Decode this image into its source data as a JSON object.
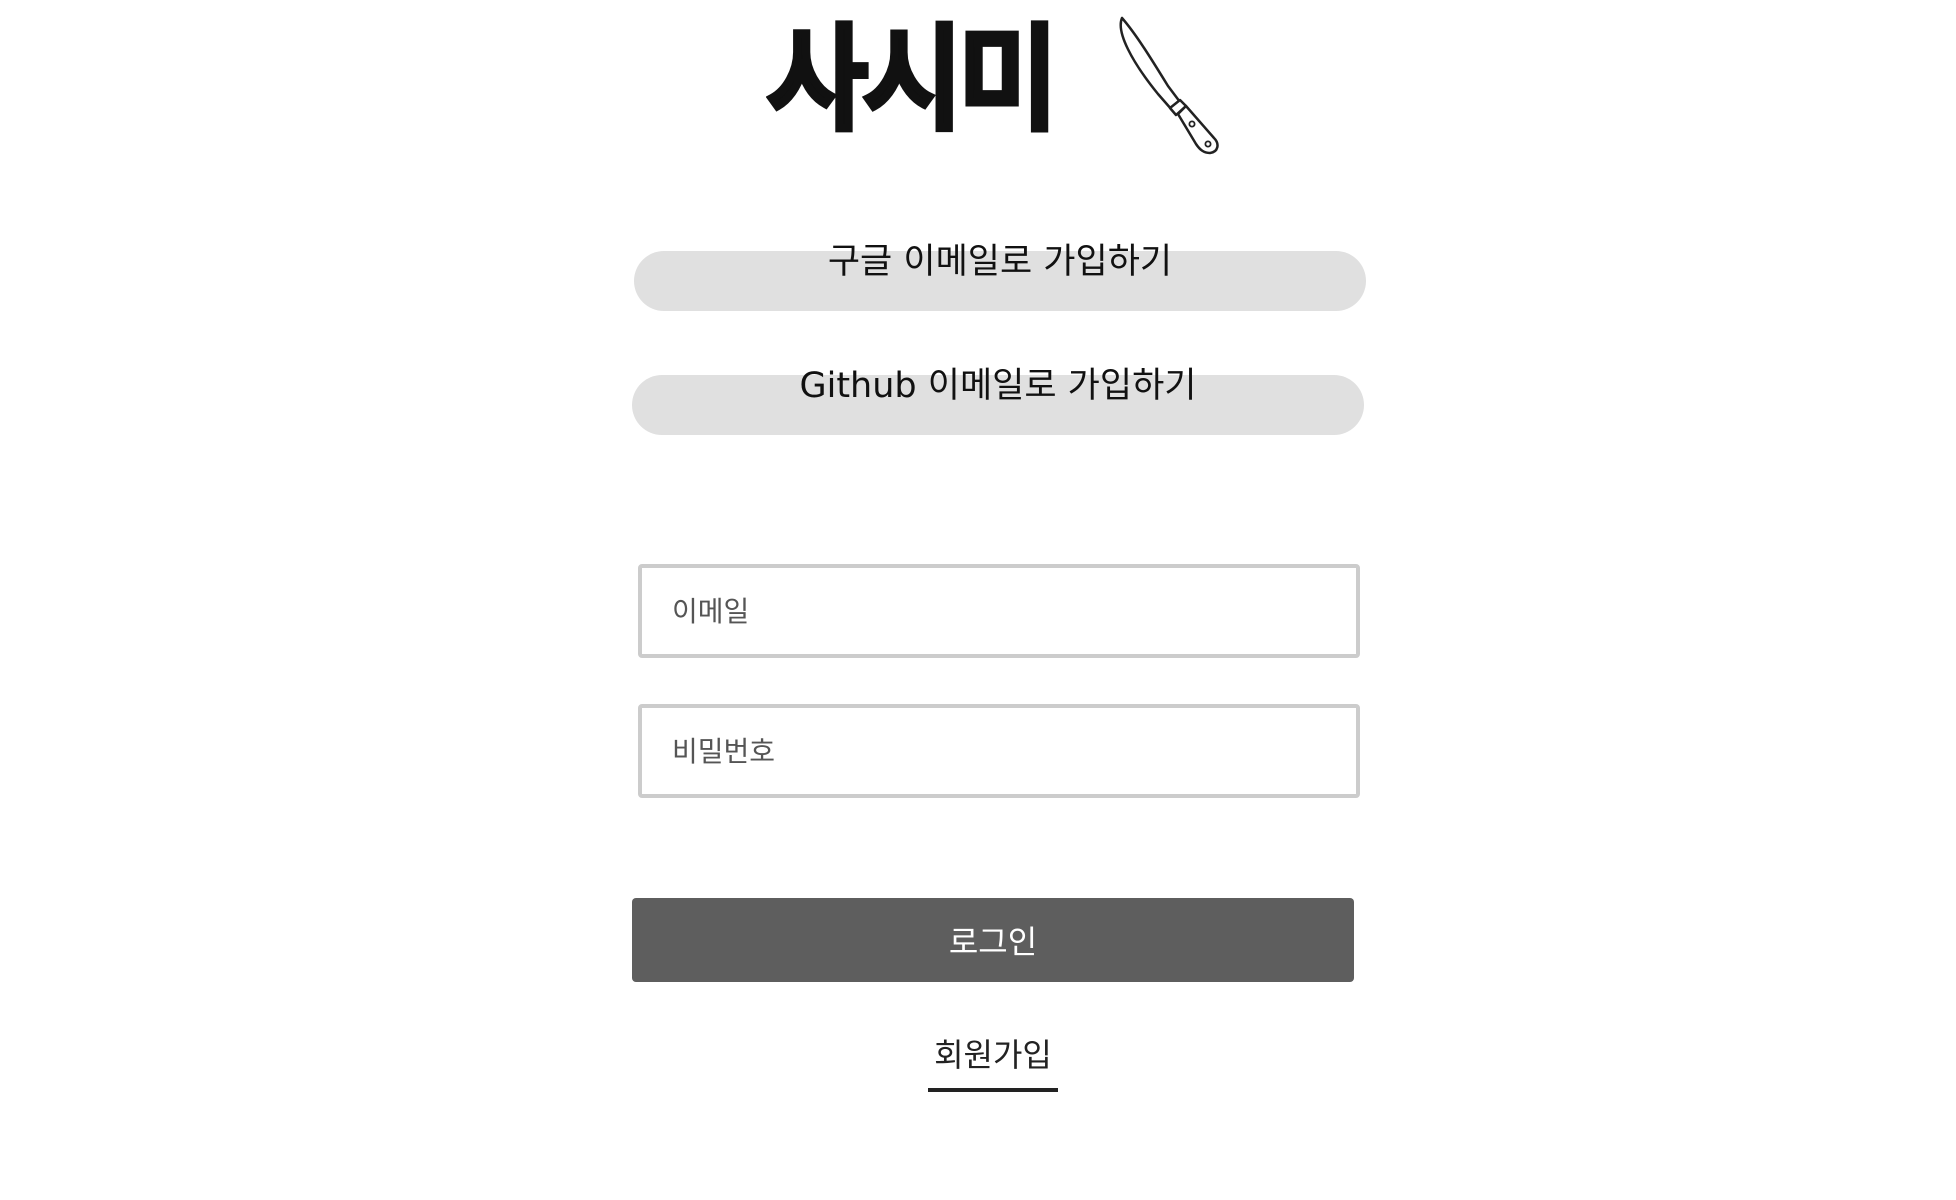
{
  "logo": {
    "text": "사시미",
    "icon": "knife-icon"
  },
  "social": {
    "google_label": "구글 이메일로 가입하기",
    "github_label": "Github 이메일로 가입하기"
  },
  "form": {
    "email_placeholder": "이메일",
    "email_value": "",
    "password_placeholder": "비밀번호",
    "password_value": "",
    "login_label": "로그인"
  },
  "signup": {
    "label": "회원가입"
  },
  "colors": {
    "background": "#ffffff",
    "social_button_bg": "#e0e0e0",
    "input_border": "#cccccc",
    "login_button_bg": "#5e5e5e",
    "text": "#111111"
  }
}
